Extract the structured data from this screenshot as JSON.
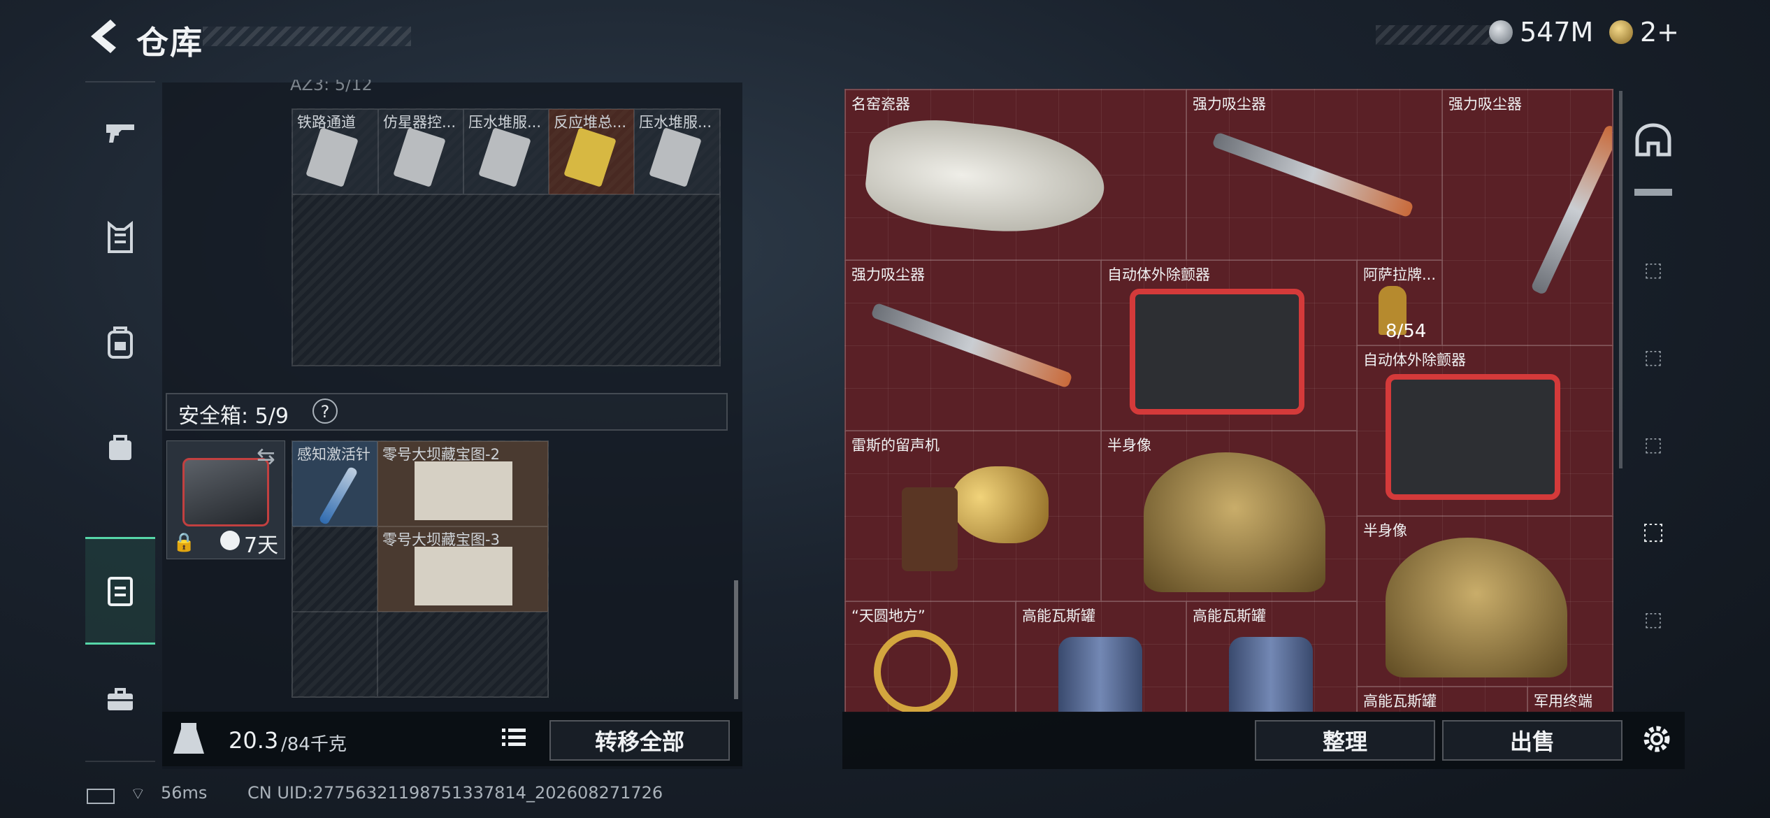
{
  "header": {
    "title": "仓库",
    "currency_amount": "547M",
    "ticket_amount": "2+"
  },
  "left_panel": {
    "partial_header": "AZ3: 5/12",
    "container_items": [
      {
        "label": "铁路通道"
      },
      {
        "label": "仿星器控..."
      },
      {
        "label": "压水堆服..."
      },
      {
        "label": "反应堆总..."
      },
      {
        "label": "压水堆服..."
      }
    ],
    "safe_box": {
      "title": "安全箱: 5/9",
      "help": "?",
      "timer": "7天"
    },
    "safe_items": [
      {
        "label": "感知激活针"
      },
      {
        "label": "零号大坝藏宝图-2"
      },
      {
        "label": "零号大坝藏宝图-3"
      }
    ],
    "weight": {
      "current": "20.3",
      "max_unit": "/84千克"
    },
    "transfer_all_label": "转移全部"
  },
  "right_panel": {
    "items": [
      {
        "name": "名窑瓷器"
      },
      {
        "name": "强力吸尘器"
      },
      {
        "name": "强力吸尘器"
      },
      {
        "name": "强力吸尘器"
      },
      {
        "name": "自动体外除颤器"
      },
      {
        "name": "阿萨拉牌...",
        "count": "8/54"
      },
      {
        "name": "自动体外除颤器"
      },
      {
        "name": "雷斯的留声机"
      },
      {
        "name": "半身像"
      },
      {
        "name": "半身像"
      },
      {
        "name": "“天圆地方”"
      },
      {
        "name": "高能瓦斯罐"
      },
      {
        "name": "高能瓦斯罐"
      },
      {
        "name": "高能瓦斯罐"
      },
      {
        "name": "军用终端"
      }
    ],
    "sort_label": "整理",
    "sell_label": "出售"
  },
  "status_bar": {
    "ping": "56ms",
    "uid": "CN UID:277563211987513378​14_202608271726"
  },
  "colors": {
    "accent": "#56d6a8",
    "grid_red": "#5a2026",
    "panel": "#121820"
  }
}
